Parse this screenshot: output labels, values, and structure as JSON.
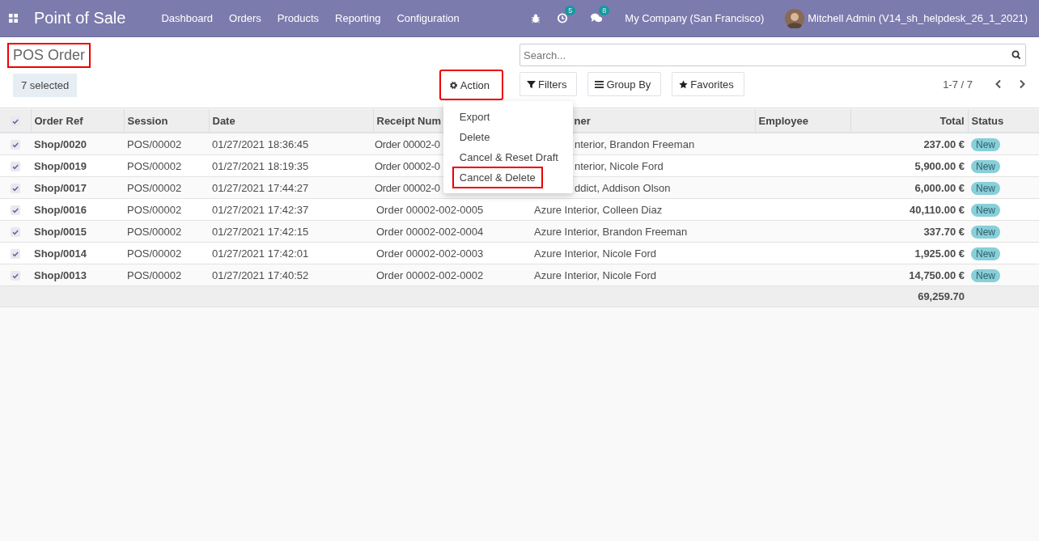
{
  "navbar": {
    "app_title": "Point of Sale",
    "menu": [
      "Dashboard",
      "Orders",
      "Products",
      "Reporting",
      "Configuration"
    ],
    "activity_count": "5",
    "message_count": "8",
    "company": "My Company (San Francisco)",
    "user": "Mitchell Admin (V14_sh_helpdesk_26_1_2021)"
  },
  "control_panel": {
    "title": "POS Order",
    "selection": "7 selected",
    "action_button": "Action",
    "search": {
      "placeholder": "Search..."
    },
    "filters": "Filters",
    "group_by": "Group By",
    "favorites": "Favorites",
    "pager": "1-7 / 7"
  },
  "action_menu": {
    "items": [
      {
        "label": "Export",
        "highlighted": false
      },
      {
        "label": "Delete",
        "highlighted": false
      },
      {
        "label": "Cancel & Reset Draft",
        "highlighted": false
      },
      {
        "label": "Cancel & Delete",
        "highlighted": true
      }
    ]
  },
  "table": {
    "all_selected": true,
    "columns": [
      "Order Ref",
      "Session",
      "Date",
      "Receipt Num",
      "ner",
      "Employee",
      "Total",
      "Status"
    ],
    "rows": [
      {
        "selected": true,
        "order_ref": "Shop/0020",
        "session": "POS/00002",
        "date": "01/27/2021 18:36:45",
        "receipt": "Order 00002-0",
        "customer": "nterior, Brandon Freeman",
        "total": "237.00 €",
        "status": "New"
      },
      {
        "selected": true,
        "order_ref": "Shop/0019",
        "session": "POS/00002",
        "date": "01/27/2021 18:19:35",
        "receipt": "Order 00002-0",
        "customer": "nterior, Nicole Ford",
        "total": "5,900.00 €",
        "status": "New"
      },
      {
        "selected": true,
        "order_ref": "Shop/0017",
        "session": "POS/00002",
        "date": "01/27/2021 17:44:27",
        "receipt": "Order 00002-0",
        "customer": "ddict, Addison Olson",
        "total": "6,000.00 €",
        "status": "New"
      },
      {
        "selected": true,
        "order_ref": "Shop/0016",
        "session": "POS/00002",
        "date": "01/27/2021 17:42:37",
        "receipt": "Order 00002-002-0005",
        "customer": "Azure Interior, Colleen Diaz",
        "total": "40,110.00 €",
        "status": "New"
      },
      {
        "selected": true,
        "order_ref": "Shop/0015",
        "session": "POS/00002",
        "date": "01/27/2021 17:42:15",
        "receipt": "Order 00002-002-0004",
        "customer": "Azure Interior, Brandon Freeman",
        "total": "337.70 €",
        "status": "New"
      },
      {
        "selected": true,
        "order_ref": "Shop/0014",
        "session": "POS/00002",
        "date": "01/27/2021 17:42:01",
        "receipt": "Order 00002-002-0003",
        "customer": "Azure Interior, Nicole Ford",
        "total": "1,925.00 €",
        "status": "New"
      },
      {
        "selected": true,
        "order_ref": "Shop/0013",
        "session": "POS/00002",
        "date": "01/27/2021 17:40:52",
        "receipt": "Order 00002-002-0002",
        "customer": "Azure Interior, Nicole Ford",
        "total": "14,750.00 €",
        "status": "New"
      }
    ],
    "sum_total": "69,259.70"
  }
}
